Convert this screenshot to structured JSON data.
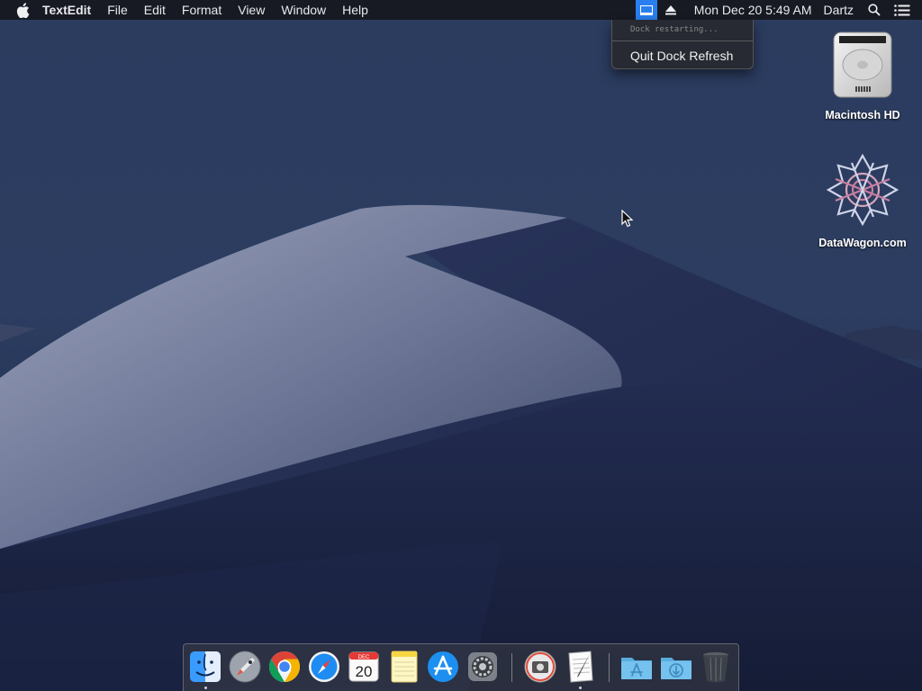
{
  "menubar": {
    "app_name": "TextEdit",
    "menus": [
      "File",
      "Edit",
      "Format",
      "View",
      "Window",
      "Help"
    ],
    "clock": "Mon Dec 20  5:49 AM",
    "user": "Dartz",
    "status_icons": [
      "dock-refresh-icon",
      "eject-icon",
      "spotlight-icon",
      "notification-center-icon"
    ]
  },
  "dropdown": {
    "status": "Dock restarting...",
    "quit_label": "Quit Dock Refresh"
  },
  "desktop": {
    "icons": [
      {
        "label": "Macintosh HD",
        "icon": "hard-drive-icon"
      },
      {
        "label": "DataWagon.com",
        "icon": "datawagon-logo-icon"
      }
    ]
  },
  "dock": {
    "apps": [
      {
        "name": "Finder",
        "icon": "finder-icon",
        "running": true
      },
      {
        "name": "Launchpad",
        "icon": "launchpad-icon",
        "running": false
      },
      {
        "name": "Google Chrome",
        "icon": "chrome-icon",
        "running": false
      },
      {
        "name": "Safari",
        "icon": "safari-icon",
        "running": false
      },
      {
        "name": "Calendar",
        "icon": "calendar-icon",
        "running": false,
        "month": "DEC",
        "day": "20"
      },
      {
        "name": "Notes",
        "icon": "notes-icon",
        "running": false
      },
      {
        "name": "App Store",
        "icon": "app-store-icon",
        "running": false
      },
      {
        "name": "System Preferences",
        "icon": "system-preferences-icon",
        "running": false
      },
      {
        "name": "Screenshot",
        "icon": "screenshot-icon",
        "running": false
      },
      {
        "name": "TextEdit",
        "icon": "textedit-icon",
        "running": true
      }
    ],
    "stacks": [
      {
        "name": "Applications",
        "icon": "applications-folder-icon"
      },
      {
        "name": "Downloads",
        "icon": "downloads-folder-icon"
      },
      {
        "name": "Trash",
        "icon": "trash-icon"
      }
    ]
  },
  "colors": {
    "menubar_bg": "#16181e",
    "highlight": "#2a7ff0",
    "sky": "#24365a",
    "dune": "#8a94b0"
  }
}
